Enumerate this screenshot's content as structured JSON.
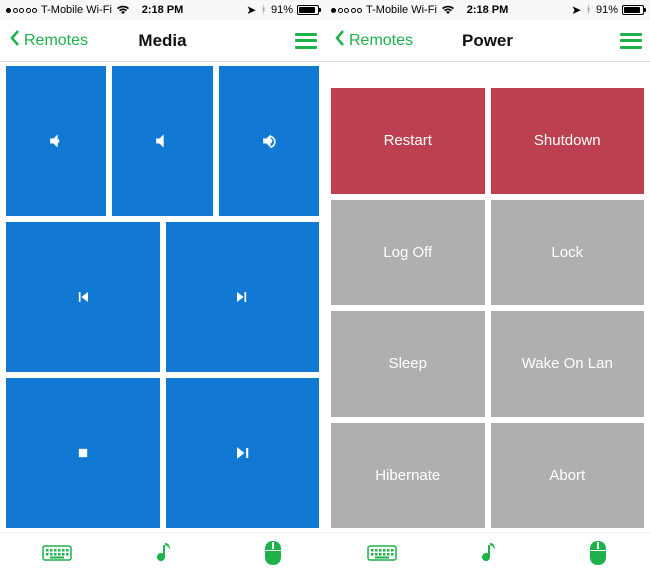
{
  "colors": {
    "accent": "#1fb24a",
    "blue": "#1179d4",
    "red": "#bc4050",
    "gray": "#aeafae"
  },
  "screens": [
    {
      "status": {
        "carrier": "T-Mobile Wi-Fi",
        "time": "2:18 PM",
        "battery_pct": "91%",
        "battery_fill": 91
      },
      "nav": {
        "back": "Remotes",
        "title": "Media"
      },
      "tiles": [
        [
          {
            "icon": "volume-down-icon",
            "style": "blue"
          },
          {
            "icon": "volume-mute-icon",
            "style": "blue"
          },
          {
            "icon": "volume-up-icon",
            "style": "blue"
          }
        ],
        [
          {
            "icon": "prev-track-icon",
            "style": "blue"
          },
          {
            "icon": "next-track-icon",
            "style": "blue"
          }
        ],
        [
          {
            "icon": "stop-icon",
            "style": "blue"
          },
          {
            "icon": "play-pause-icon",
            "style": "blue"
          }
        ]
      ]
    },
    {
      "status": {
        "carrier": "T-Mobile Wi-Fi",
        "time": "2:18 PM",
        "battery_pct": "91%",
        "battery_fill": 91
      },
      "nav": {
        "back": "Remotes",
        "title": "Power"
      },
      "rowspacer": true,
      "tiles": [
        [
          {
            "label": "Restart",
            "style": "red"
          },
          {
            "label": "Shutdown",
            "style": "red"
          }
        ],
        [
          {
            "label": "Log Off",
            "style": "gray"
          },
          {
            "label": "Lock",
            "style": "gray"
          }
        ],
        [
          {
            "label": "Sleep",
            "style": "gray"
          },
          {
            "label": "Wake On Lan",
            "style": "gray"
          }
        ],
        [
          {
            "label": "Hibernate",
            "style": "gray"
          },
          {
            "label": "Abort",
            "style": "gray"
          }
        ]
      ]
    }
  ],
  "toolbar": [
    "keyboard-icon",
    "music-icon",
    "mouse-icon"
  ]
}
